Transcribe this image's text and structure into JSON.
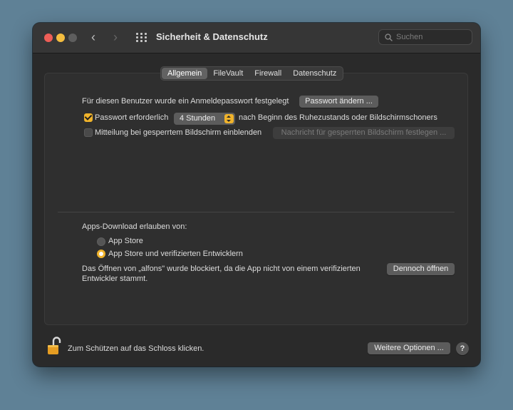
{
  "window": {
    "title": "Sicherheit & Datenschutz"
  },
  "search": {
    "placeholder": "Suchen"
  },
  "tabs": [
    "Allgemein",
    "FileVault",
    "Firewall",
    "Datenschutz"
  ],
  "general": {
    "password_text": "Für diesen Benutzer wurde ein Anmeldepasswort festgelegt",
    "change_password_button": "Passwort ändern ...",
    "require_password_label": "Passwort erforderlich",
    "require_password_checked": true,
    "require_password_delay": "4 Stunden",
    "require_password_suffix": "nach Beginn des Ruhezustands oder Bildschirmschoners",
    "lock_message_label": "Mitteilung bei gesperrtem Bildschirm einblenden",
    "lock_message_checked": false,
    "lock_message_button": "Nachricht für gesperrten Bildschirm festlegen ..."
  },
  "downloads": {
    "heading": "Apps-Download erlauben von:",
    "options": [
      {
        "label": "App Store",
        "selected": false
      },
      {
        "label": "App Store und verifizierten Entwicklern",
        "selected": true
      }
    ],
    "blocked_line1": "Das Öffnen von „alfons\" wurde blockiert, da die App nicht von einem verifizierten",
    "blocked_line2": "Entwickler stammt.",
    "open_anyway_button": "Dennoch öffnen"
  },
  "footer": {
    "lock_text": "Zum Schützen auf das Schloss klicken.",
    "more_options_button": "Weitere Optionen ...",
    "help_label": "?"
  },
  "colors": {
    "accent": "#f0b32b",
    "background": "#5f8196",
    "window": "#2a2a2a"
  }
}
